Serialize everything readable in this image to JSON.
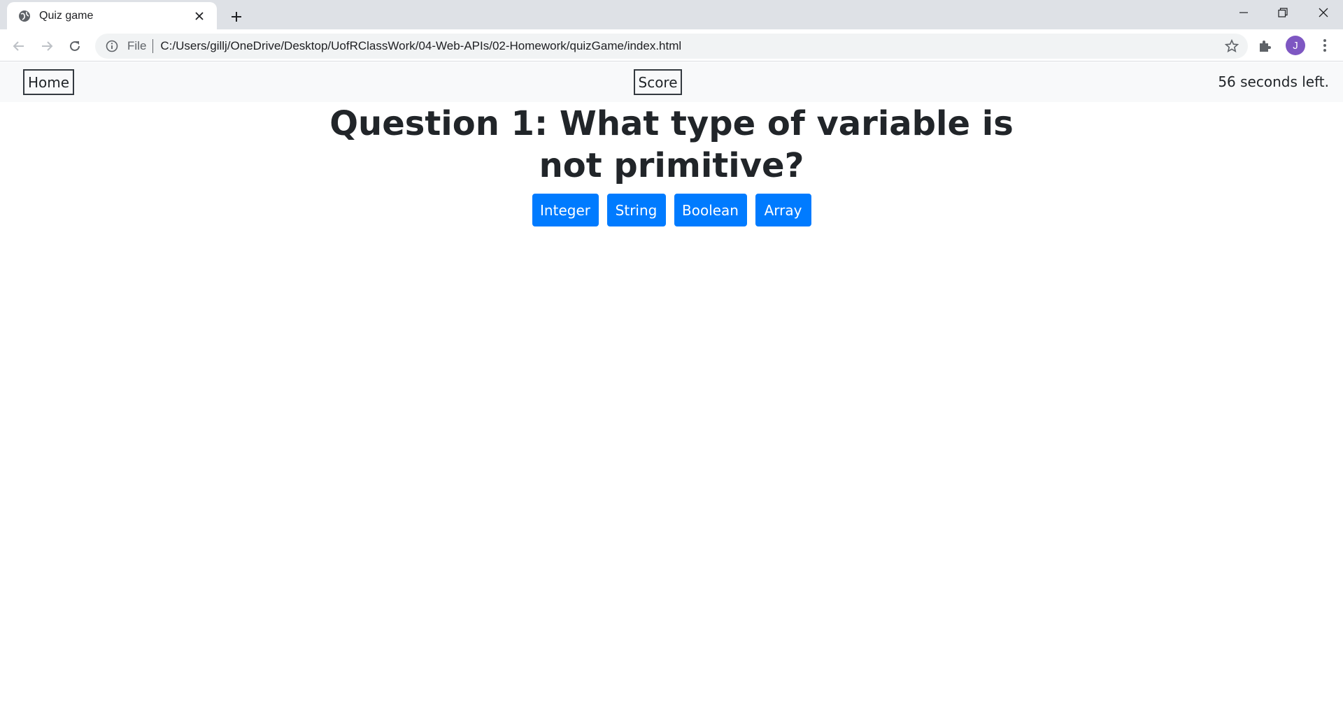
{
  "browser": {
    "tab_title": "Quiz game",
    "scheme_label": "File",
    "url": "C:/Users/gillj/OneDrive/Desktop/UofRClassWork/04-Web-APIs/02-Homework/quizGame/index.html",
    "profile_initial": "J",
    "profile_color": "#7e57c2"
  },
  "navbar": {
    "home_label": "Home",
    "score_label": "Score",
    "timer_text": "56 seconds left."
  },
  "quiz": {
    "question": "Question 1: What type of variable is not primitive?",
    "answers": [
      "Integer",
      "String",
      "Boolean",
      "Array"
    ],
    "answer_color": "#007bff"
  }
}
